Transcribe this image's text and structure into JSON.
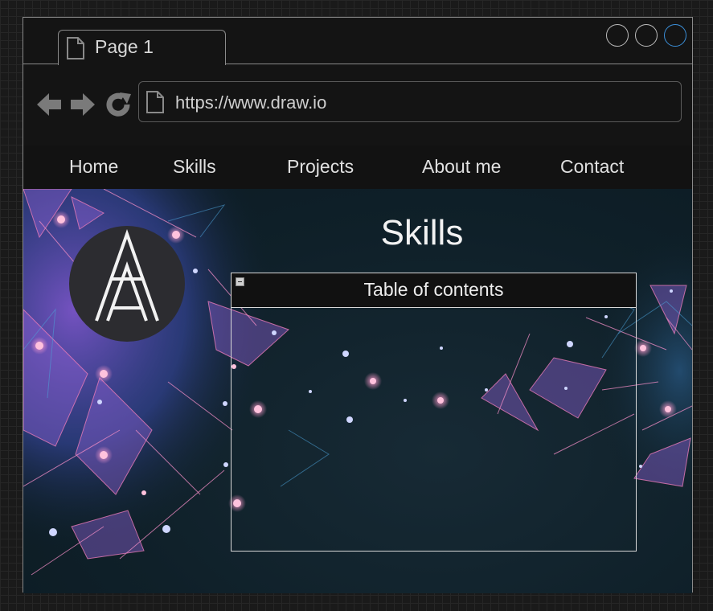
{
  "browser": {
    "tab_title": "Page 1",
    "url": "https://www.draw.io",
    "icons": {
      "tab": "document-icon",
      "url": "document-icon",
      "back": "arrow-left-icon",
      "forward": "arrow-right-icon",
      "reload": "reload-icon"
    },
    "window_buttons": [
      "minimize",
      "maximize",
      "close"
    ],
    "colors": {
      "active_window_button": "#3b8fd9",
      "window_border": "#8a8a8a"
    }
  },
  "menu": {
    "items": [
      "Home",
      "Skills",
      "Projects",
      "About me",
      "Contact"
    ]
  },
  "page": {
    "heading": "Skills",
    "logo": "AA-monogram-logo"
  },
  "toc": {
    "title": "Table of contents",
    "collapse_icon": "minus-icon"
  },
  "colors": {
    "accent_pink": "#e87bb8",
    "accent_purple": "#7a55c8",
    "background_dark": "#0f2029"
  }
}
